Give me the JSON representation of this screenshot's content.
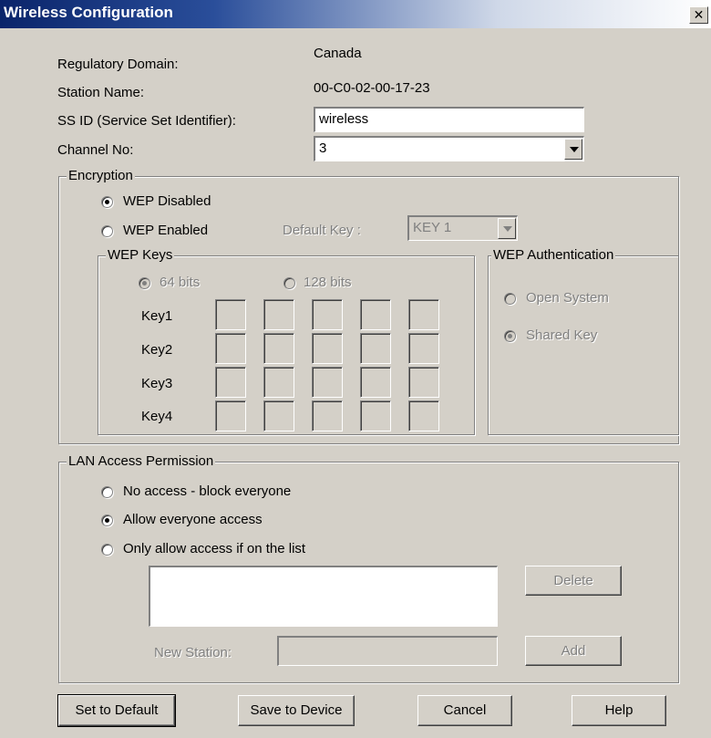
{
  "window": {
    "title": "Wireless Configuration"
  },
  "info": {
    "regulatory_label": "Regulatory Domain:",
    "regulatory_value": "Canada",
    "station_label": "Station Name:",
    "station_value": "00-C0-02-00-17-23",
    "ssid_label": "SS ID (Service Set Identifier):",
    "ssid_value": "wireless",
    "channel_label": "Channel No:",
    "channel_value": "3"
  },
  "encryption": {
    "legend": "Encryption",
    "wep_disabled": "WEP Disabled",
    "wep_enabled": "WEP Enabled",
    "selected": "WEP Disabled",
    "default_key_label": "Default Key :",
    "default_key_value": "KEY 1",
    "wep_keys": {
      "legend": "WEP Keys",
      "bits64": "64 bits",
      "bits128": "128 bits",
      "selected": "64 bits",
      "rows": [
        "Key1",
        "Key2",
        "Key3",
        "Key4"
      ]
    },
    "auth": {
      "legend": "WEP Authentication",
      "open": "Open System",
      "shared": "Shared Key",
      "selected": "Shared Key"
    }
  },
  "lan": {
    "legend": "LAN Access Permission",
    "no_access": "No access -  block everyone",
    "allow_all": "Allow everyone access",
    "only_list": "Only allow access if on the list",
    "selected": "Allow everyone access",
    "delete_label": "Delete",
    "new_station_label": "New Station:",
    "new_station_value": "",
    "add_label": "Add"
  },
  "buttons": {
    "set_default": "Set to Default",
    "save": "Save to Device",
    "cancel": "Cancel",
    "help": "Help"
  }
}
